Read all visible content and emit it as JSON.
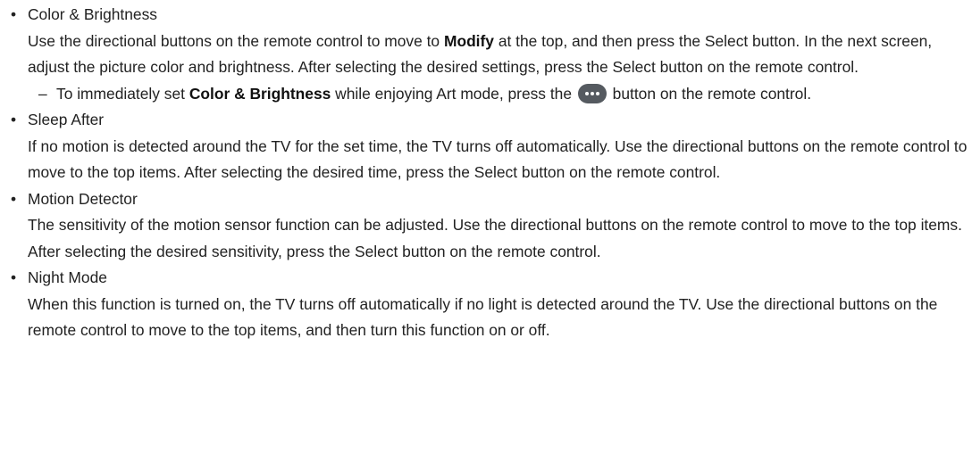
{
  "sections": [
    {
      "heading": "Color & Brightness",
      "body": {
        "part1": "Use the directional buttons on the remote control to move to ",
        "bold1": "Modify",
        "part2": " at the top, and then press the Select button. In the next screen, adjust the picture color and brightness. After selecting the desired settings, press the Select button on the remote control."
      },
      "note": {
        "dash": "–",
        "part1": "To immediately set ",
        "bold1": "Color & Brightness",
        "part2": " while enjoying Art mode, press the ",
        "icon": "more-button-icon",
        "part3": " button on the remote control."
      }
    },
    {
      "heading": "Sleep After",
      "body": "If no motion is detected around the TV for the set time, the TV turns off automatically. Use the directional buttons on the remote control to move to the top items. After selecting the desired time, press the Select button on the remote control."
    },
    {
      "heading": "Motion Detector",
      "body": "The sensitivity of the motion sensor function can be adjusted. Use the directional buttons on the remote control to move to the top items. After selecting the desired sensitivity, press the Select button on the remote control."
    },
    {
      "heading": "Night Mode",
      "body": "When this function is turned on, the TV turns off automatically if no light is detected around the TV. Use the directional buttons on the remote control to move to the top items, and then turn this function on or off."
    }
  ],
  "bullet_glyph": "•",
  "colors": {
    "text": "#222222",
    "icon_background": "#555a60"
  }
}
